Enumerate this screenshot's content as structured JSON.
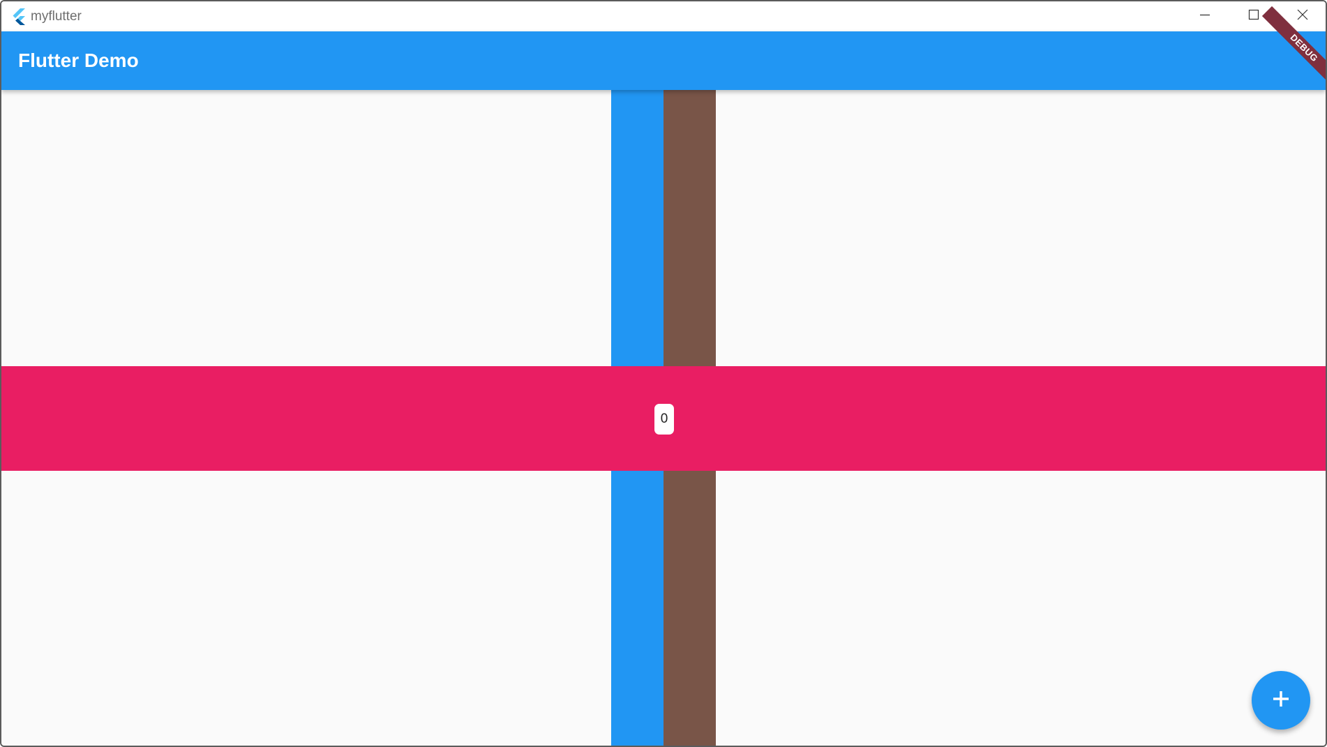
{
  "window": {
    "title": "myflutter",
    "logo_icon": "flutter-logo-icon",
    "controls": {
      "minimize_icon": "minimize-icon",
      "maximize_icon": "maximize-icon",
      "close_icon": "close-icon"
    }
  },
  "appbar": {
    "title": "Flutter Demo",
    "debug_banner": "DEBUG",
    "color": "#2196f3"
  },
  "body": {
    "counter_value": "0",
    "colors": {
      "column_left": "#2196f3",
      "column_right": "#795548",
      "row_band": "#e91e63",
      "background": "#fafafa"
    }
  },
  "fab": {
    "icon": "plus-icon",
    "color": "#2196f3"
  }
}
